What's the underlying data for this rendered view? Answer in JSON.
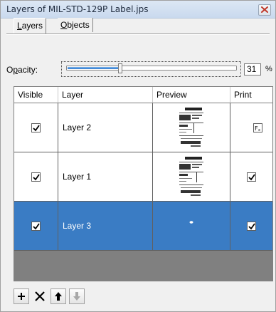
{
  "window": {
    "title": "Layers of MIL-STD-129P Label.jps"
  },
  "tabs": [
    {
      "label": "Layers",
      "mnemonic": "L",
      "rest": "ayers",
      "active": true
    },
    {
      "label": "Objects",
      "mnemonic": "O",
      "rest": "bjects",
      "active": false
    }
  ],
  "opacity": {
    "label_pre": "O",
    "label_mnemonic": "p",
    "label_post": "acity:",
    "value": "31",
    "unit": "%",
    "percent": 31
  },
  "layers_table": {
    "columns": [
      "Visible",
      "Layer",
      "Preview",
      "Print"
    ],
    "rows": [
      {
        "name": "Layer 2",
        "visible": true,
        "print": "fx",
        "selected": false
      },
      {
        "name": "Layer 1",
        "visible": true,
        "print": "checked",
        "selected": false
      },
      {
        "name": "Layer 3",
        "visible": true,
        "print": "checked",
        "selected": true
      }
    ]
  },
  "toolbar": {
    "buttons": [
      {
        "icon": "plus-icon",
        "enabled": true
      },
      {
        "icon": "delete-x-icon",
        "enabled": true
      },
      {
        "icon": "arrow-up-icon",
        "enabled": true
      },
      {
        "icon": "arrow-down-icon",
        "enabled": false
      }
    ]
  },
  "colors": {
    "selection": "#3a7cc4",
    "grid_background": "#808080"
  }
}
